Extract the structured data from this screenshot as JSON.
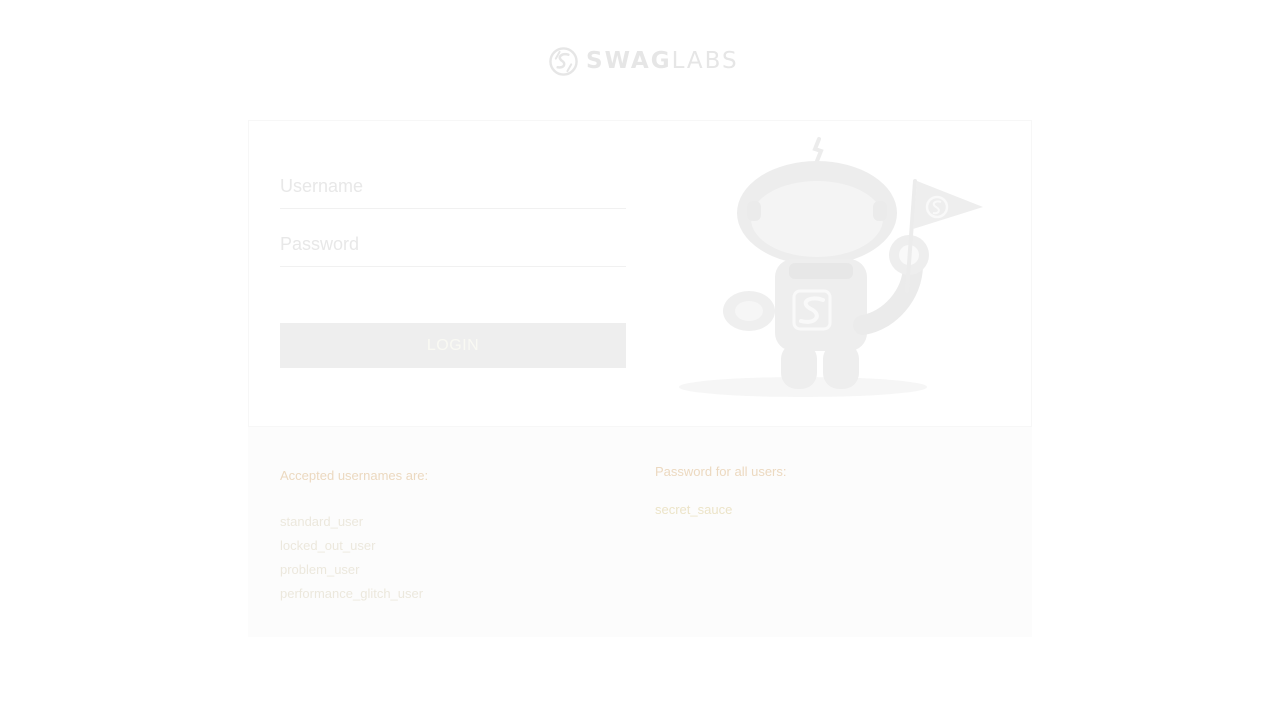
{
  "brand": {
    "logo_text_bold": "SWAG",
    "logo_text_light": "LABS"
  },
  "login_form": {
    "username_placeholder": "Username",
    "password_placeholder": "Password",
    "login_button_label": "LOGIN"
  },
  "credentials": {
    "usernames_heading": "Accepted usernames are:",
    "usernames": [
      "standard_user",
      "locked_out_user",
      "problem_user",
      "performance_glitch_user"
    ],
    "password_heading": "Password for all users:",
    "password": "secret_sauce"
  },
  "colors": {
    "background": "#ffffff",
    "button": "#eeeeee",
    "panel": "#fcfcfc",
    "logo": "#e6e6e6"
  }
}
